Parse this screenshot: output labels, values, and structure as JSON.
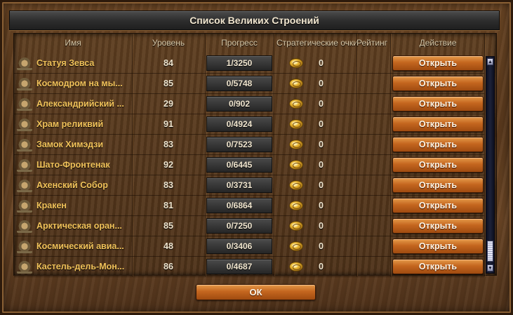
{
  "window": {
    "title": "Список Великих Строений"
  },
  "columns": {
    "name": "Имя",
    "level": "Уровень",
    "progress": "Прогресс",
    "strategy_points": "Стратегические очки",
    "rating": "Рейтинг",
    "action": "Действие"
  },
  "rows": [
    {
      "name": "Статуя Зевса",
      "level": "84",
      "progress": "1/3250",
      "points": "0",
      "action": "Открыть",
      "icon": "statue-icon"
    },
    {
      "name": "Космодром на мы...",
      "level": "85",
      "progress": "0/5748",
      "points": "0",
      "action": "Открыть",
      "icon": "spaceport-icon"
    },
    {
      "name": "Александрийский ...",
      "level": "29",
      "progress": "0/902",
      "points": "0",
      "action": "Открыть",
      "icon": "lighthouse-icon"
    },
    {
      "name": "Храм реликвий",
      "level": "91",
      "progress": "0/4924",
      "points": "0",
      "action": "Открыть",
      "icon": "temple-icon"
    },
    {
      "name": "Замок Химэдзи",
      "level": "83",
      "progress": "0/7523",
      "points": "0",
      "action": "Открыть",
      "icon": "castle-icon"
    },
    {
      "name": "Шато-Фронтенак",
      "level": "92",
      "progress": "0/6445",
      "points": "0",
      "action": "Открыть",
      "icon": "chateau-icon"
    },
    {
      "name": "Ахенский Собор",
      "level": "83",
      "progress": "0/3731",
      "points": "0",
      "action": "Открыть",
      "icon": "cathedral-icon"
    },
    {
      "name": "Кракен",
      "level": "81",
      "progress": "0/6864",
      "points": "0",
      "action": "Открыть",
      "icon": "kraken-icon"
    },
    {
      "name": "Арктическая оран...",
      "level": "85",
      "progress": "0/7250",
      "points": "0",
      "action": "Открыть",
      "icon": "orangery-icon"
    },
    {
      "name": "Космический авиа...",
      "level": "48",
      "progress": "0/3406",
      "points": "0",
      "action": "Открыть",
      "icon": "carrier-icon"
    },
    {
      "name": "Кастель-дель-Мон...",
      "level": "86",
      "progress": "0/4687",
      "points": "0",
      "action": "Открыть",
      "icon": "fortress-icon"
    }
  ],
  "footer": {
    "ok_label": "ОК"
  },
  "colors": {
    "name_text": "#f2c35a",
    "button": "#c4661f",
    "panel": "#5e3e20"
  }
}
